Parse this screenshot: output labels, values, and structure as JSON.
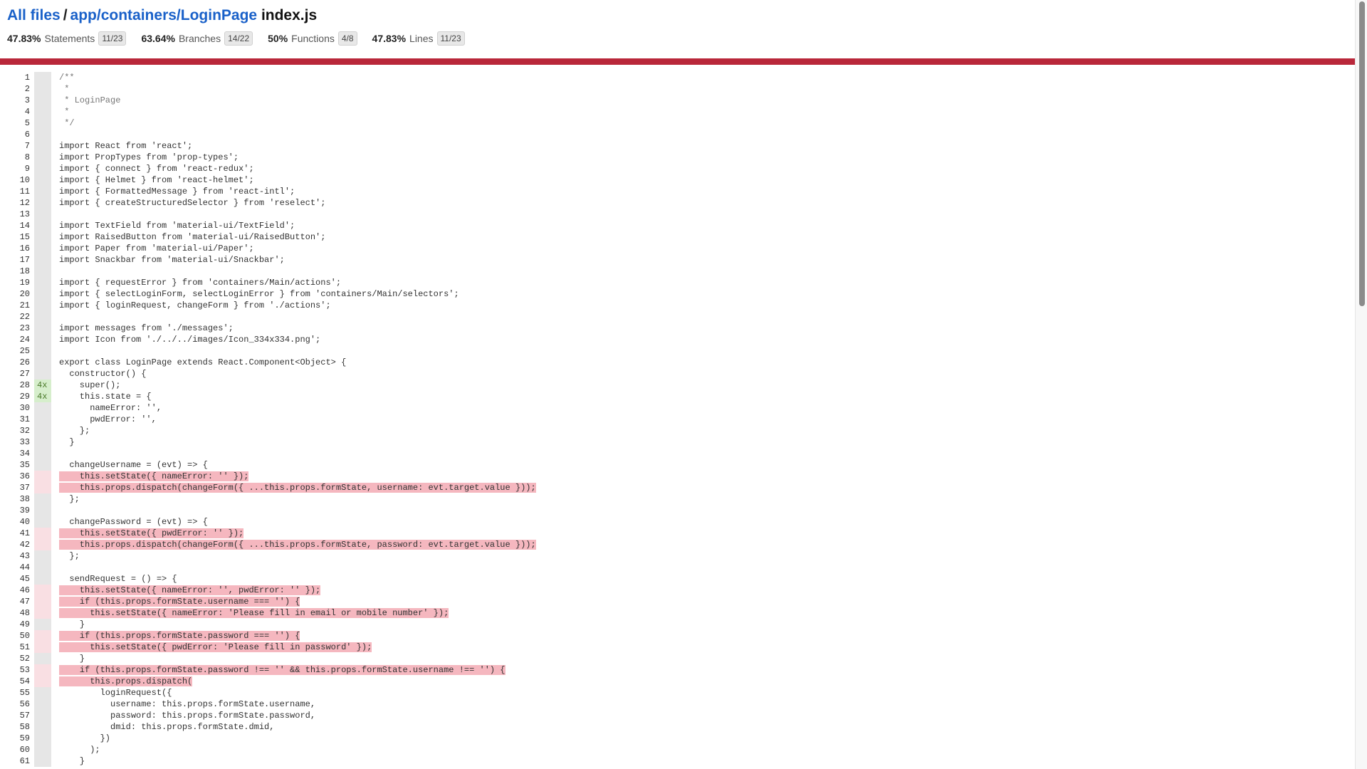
{
  "header": {
    "all_files": "All files",
    "path": "app/containers/LoginPage",
    "separator": "/",
    "filename": "index.js"
  },
  "stats": [
    {
      "pct": "47.83%",
      "label": "Statements",
      "frac": "11/23"
    },
    {
      "pct": "63.64%",
      "label": "Branches",
      "frac": "14/22"
    },
    {
      "pct": "50%",
      "label": "Functions",
      "frac": "4/8"
    },
    {
      "pct": "47.83%",
      "label": "Lines",
      "frac": "11/23"
    }
  ],
  "colors": {
    "status_bar": "#b9273a",
    "link": "#1a61c9",
    "uncovered": "#f5b7bf",
    "covered_gutter": "#d6eecc"
  },
  "lines": [
    {
      "n": "1",
      "h": "",
      "t": "/**",
      "c": "com"
    },
    {
      "n": "2",
      "h": "",
      "t": " *",
      "c": "com"
    },
    {
      "n": "3",
      "h": "",
      "t": " * LoginPage",
      "c": "com"
    },
    {
      "n": "4",
      "h": "",
      "t": " *",
      "c": "com"
    },
    {
      "n": "5",
      "h": "",
      "t": " */",
      "c": "com"
    },
    {
      "n": "6",
      "h": "",
      "t": ""
    },
    {
      "n": "7",
      "h": "",
      "t": "import React from 'react';"
    },
    {
      "n": "8",
      "h": "",
      "t": "import PropTypes from 'prop-types';"
    },
    {
      "n": "9",
      "h": "",
      "t": "import { connect } from 'react-redux';"
    },
    {
      "n": "10",
      "h": "",
      "t": "import { Helmet } from 'react-helmet';"
    },
    {
      "n": "11",
      "h": "",
      "t": "import { FormattedMessage } from 'react-intl';"
    },
    {
      "n": "12",
      "h": "",
      "t": "import { createStructuredSelector } from 'reselect';"
    },
    {
      "n": "13",
      "h": "",
      "t": ""
    },
    {
      "n": "14",
      "h": "",
      "t": "import TextField from 'material-ui/TextField';"
    },
    {
      "n": "15",
      "h": "",
      "t": "import RaisedButton from 'material-ui/RaisedButton';"
    },
    {
      "n": "16",
      "h": "",
      "t": "import Paper from 'material-ui/Paper';"
    },
    {
      "n": "17",
      "h": "",
      "t": "import Snackbar from 'material-ui/Snackbar';"
    },
    {
      "n": "18",
      "h": "",
      "t": ""
    },
    {
      "n": "19",
      "h": "",
      "t": "import { requestError } from 'containers/Main/actions';"
    },
    {
      "n": "20",
      "h": "",
      "t": "import { selectLoginForm, selectLoginError } from 'containers/Main/selectors';"
    },
    {
      "n": "21",
      "h": "",
      "t": "import { loginRequest, changeForm } from './actions';"
    },
    {
      "n": "22",
      "h": "",
      "t": ""
    },
    {
      "n": "23",
      "h": "",
      "t": "import messages from './messages';"
    },
    {
      "n": "24",
      "h": "",
      "t": "import Icon from './../../images/Icon_334x334.png';"
    },
    {
      "n": "25",
      "h": "",
      "t": ""
    },
    {
      "n": "26",
      "h": "",
      "t": "export class LoginPage extends React.Component<Object> {"
    },
    {
      "n": "27",
      "h": "",
      "t": "  constructor() {"
    },
    {
      "n": "28",
      "h": "4x",
      "cov": "covered",
      "t": "    super();"
    },
    {
      "n": "29",
      "h": "4x",
      "cov": "covered",
      "t": "    this.state = {"
    },
    {
      "n": "30",
      "h": "",
      "t": "      nameError: '',"
    },
    {
      "n": "31",
      "h": "",
      "t": "      pwdError: '',"
    },
    {
      "n": "32",
      "h": "",
      "t": "    };"
    },
    {
      "n": "33",
      "h": "",
      "t": "  }"
    },
    {
      "n": "34",
      "h": "",
      "t": ""
    },
    {
      "n": "35",
      "h": "",
      "t": "  changeUsername = (evt) => {"
    },
    {
      "n": "36",
      "h": "",
      "cov": "missed",
      "t": "    this.setState({ nameError: '' });",
      "hl": true
    },
    {
      "n": "37",
      "h": "",
      "cov": "missed",
      "t": "    this.props.dispatch(changeForm({ ...this.props.formState, username: evt.target.value }));",
      "hl": true
    },
    {
      "n": "38",
      "h": "",
      "t": "  };"
    },
    {
      "n": "39",
      "h": "",
      "t": ""
    },
    {
      "n": "40",
      "h": "",
      "t": "  changePassword = (evt) => {"
    },
    {
      "n": "41",
      "h": "",
      "cov": "missed",
      "t": "    this.setState({ pwdError: '' });",
      "hl": true
    },
    {
      "n": "42",
      "h": "",
      "cov": "missed",
      "t": "    this.props.dispatch(changeForm({ ...this.props.formState, password: evt.target.value }));",
      "hl": true
    },
    {
      "n": "43",
      "h": "",
      "t": "  };"
    },
    {
      "n": "44",
      "h": "",
      "t": ""
    },
    {
      "n": "45",
      "h": "",
      "t": "  sendRequest = () => {"
    },
    {
      "n": "46",
      "h": "",
      "cov": "missed",
      "t": "    this.setState({ nameError: '', pwdError: '' });",
      "hl": true
    },
    {
      "n": "47",
      "h": "",
      "cov": "missed",
      "t": "    if (this.props.formState.username === '') {",
      "hl": true
    },
    {
      "n": "48",
      "h": "",
      "cov": "missed",
      "t": "      this.setState({ nameError: 'Please fill in email or mobile number' });",
      "hl": true
    },
    {
      "n": "49",
      "h": "",
      "t": "    }"
    },
    {
      "n": "50",
      "h": "",
      "cov": "missed",
      "t": "    if (this.props.formState.password === '') {",
      "hl": true
    },
    {
      "n": "51",
      "h": "",
      "cov": "missed",
      "t": "      this.setState({ pwdError: 'Please fill in password' });",
      "hl": true
    },
    {
      "n": "52",
      "h": "",
      "t": "    }"
    },
    {
      "n": "53",
      "h": "",
      "cov": "missed",
      "t": "    if (this.props.formState.password !== '' && this.props.formState.username !== '') {",
      "hl": true
    },
    {
      "n": "54",
      "h": "",
      "cov": "missed",
      "t": "      this.props.dispatch(",
      "hl": true
    },
    {
      "n": "55",
      "h": "",
      "t": "        loginRequest({"
    },
    {
      "n": "56",
      "h": "",
      "t": "          username: this.props.formState.username,"
    },
    {
      "n": "57",
      "h": "",
      "t": "          password: this.props.formState.password,"
    },
    {
      "n": "58",
      "h": "",
      "t": "          dmid: this.props.formState.dmid,"
    },
    {
      "n": "59",
      "h": "",
      "t": "        })"
    },
    {
      "n": "60",
      "h": "",
      "t": "      );"
    },
    {
      "n": "61",
      "h": "",
      "t": "    }"
    }
  ]
}
